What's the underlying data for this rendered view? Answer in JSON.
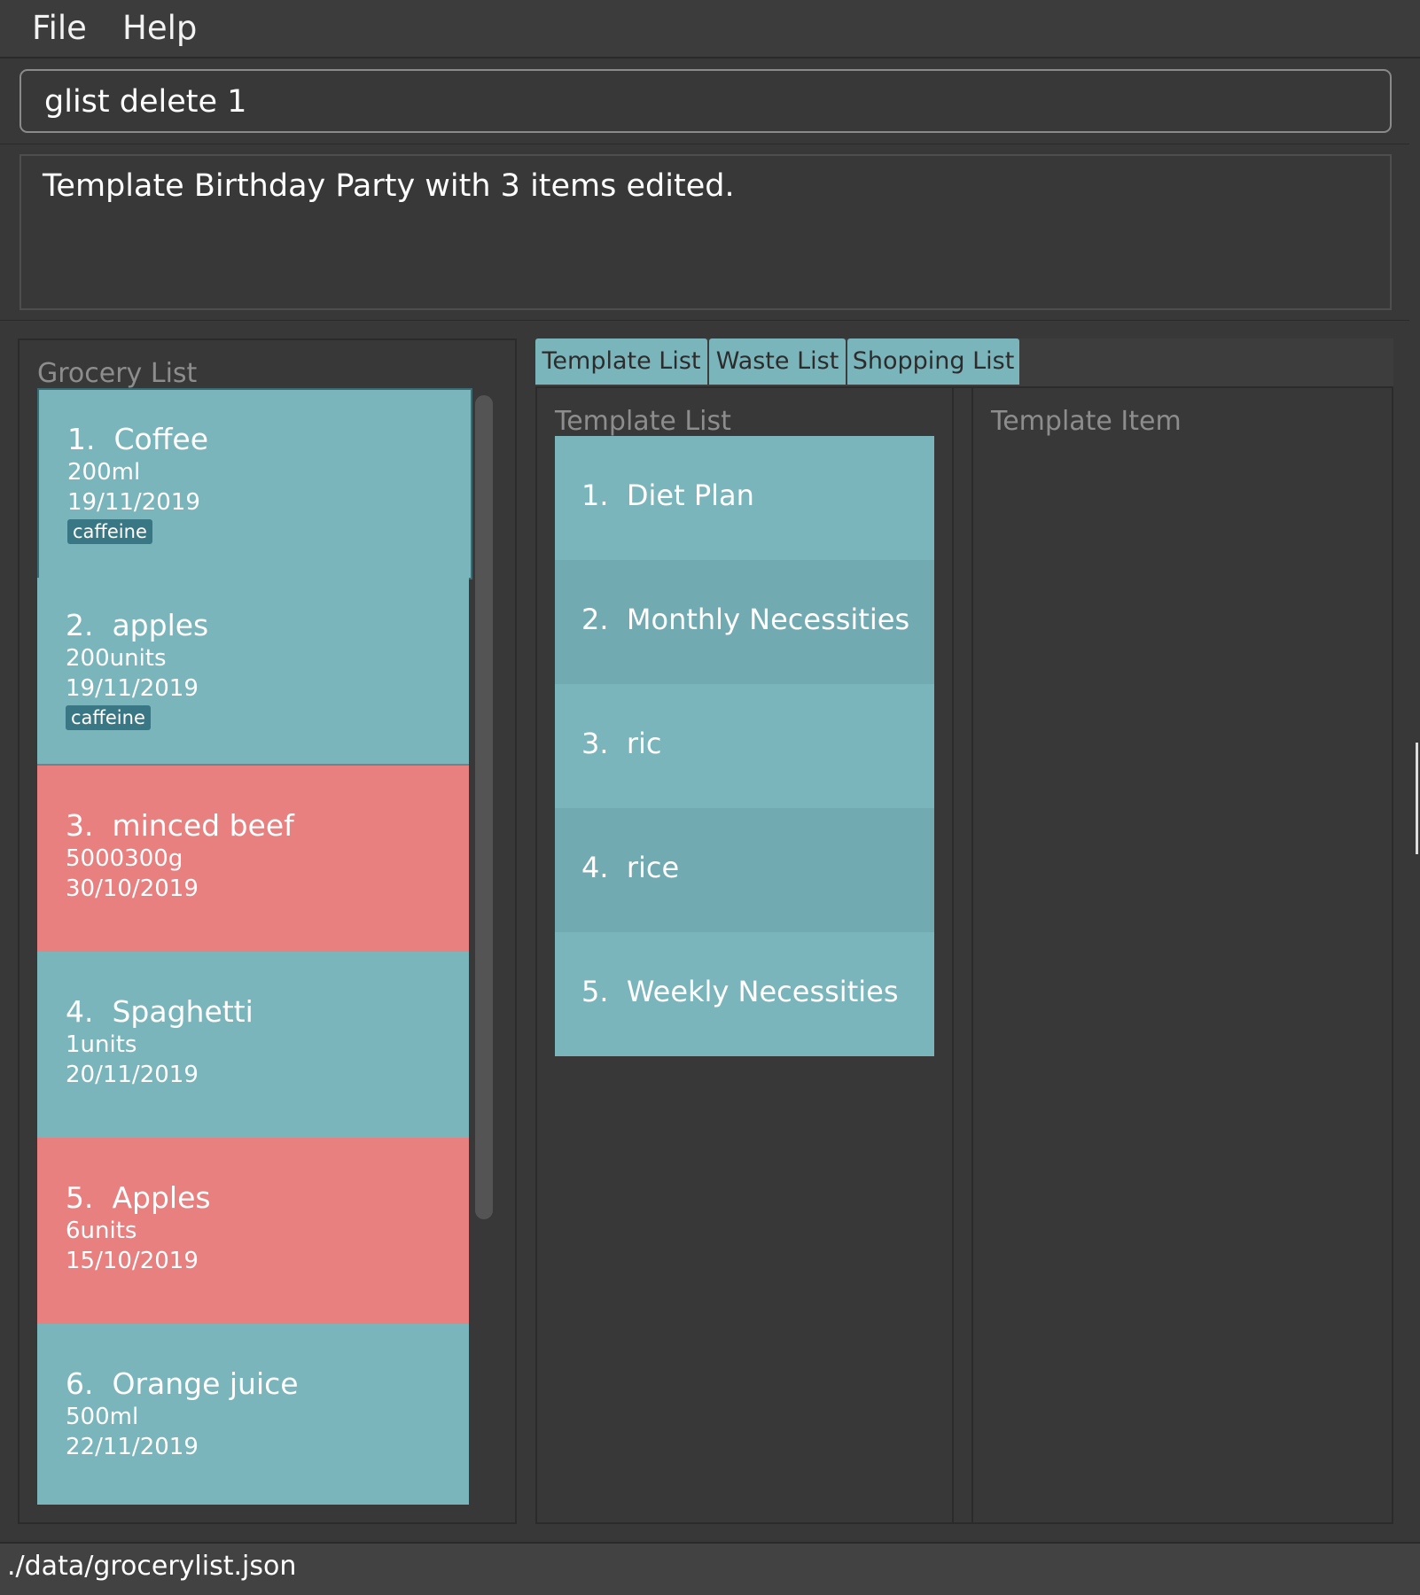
{
  "menu": {
    "file": "File",
    "help": "Help"
  },
  "command": {
    "value": "glist delete 1"
  },
  "result": {
    "message": "Template Birthday Party with 3 items edited."
  },
  "grocery": {
    "title": "Grocery List",
    "items": [
      {
        "name": "1.  Coffee",
        "amount": "200ml",
        "date": "19/11/2019",
        "tag": "caffeine",
        "status": "normal",
        "color": "#7bb5bc"
      },
      {
        "name": "2.  apples",
        "amount": "200units",
        "date": "19/11/2019",
        "tag": "caffeine",
        "status": "normal",
        "color": "#7bb5bc"
      },
      {
        "name": "3.  minced beef",
        "amount": "5000300g",
        "date": "30/10/2019",
        "status": "expired",
        "color": "#e88080"
      },
      {
        "name": "4.  Spaghetti",
        "amount": "1units",
        "date": "20/11/2019",
        "status": "normal",
        "color": "#7bb5bc"
      },
      {
        "name": "5.  Apples",
        "amount": "6units",
        "date": "15/10/2019",
        "status": "expired",
        "color": "#e88080"
      },
      {
        "name": "6.  Orange juice",
        "amount": "500ml",
        "date": "22/11/2019",
        "status": "normal",
        "color": "#7bb5bc"
      }
    ]
  },
  "tabs": [
    {
      "label": "Template List",
      "selected": true
    },
    {
      "label": "Waste List",
      "selected": false
    },
    {
      "label": "Shopping List",
      "selected": false
    }
  ],
  "template_list": {
    "title": "Template List",
    "items": [
      "1.  Diet Plan",
      "2.  Monthly Necessities",
      "3.  ric",
      "4.  rice",
      "5.  Weekly Necessities"
    ]
  },
  "template_item": {
    "title": "Template Item"
  },
  "status_bar": {
    "path": "./data/grocerylist.json"
  },
  "colors": {
    "background": "#383838",
    "card_teal": "#7bb5bc",
    "card_red": "#e88080",
    "tag_bg": "#3a7784"
  }
}
